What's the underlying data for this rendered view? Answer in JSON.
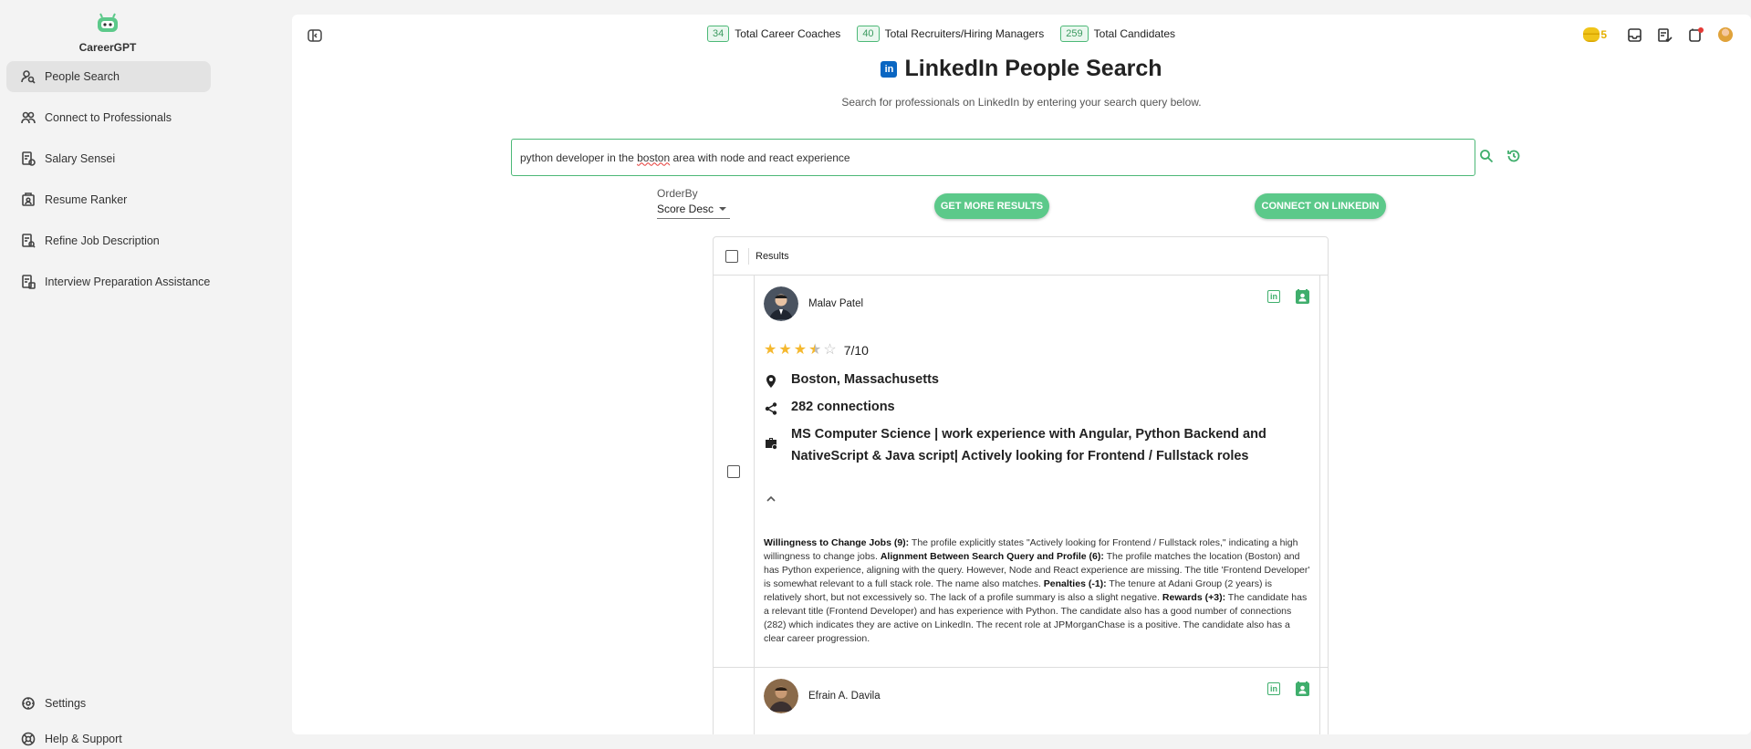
{
  "app": {
    "name": "CareerGPT"
  },
  "sidebar": {
    "items": [
      {
        "label": "People Search",
        "icon": "person-search-icon",
        "active": true
      },
      {
        "label": "Connect to Professionals",
        "icon": "people-icon",
        "active": false
      },
      {
        "label": "Salary Sensei",
        "icon": "salary-doc-icon",
        "active": false
      },
      {
        "label": "Resume Ranker",
        "icon": "resume-icon",
        "active": false
      },
      {
        "label": "Refine Job Description",
        "icon": "job-description-icon",
        "active": false
      },
      {
        "label": "Interview Preparation Assistance",
        "icon": "interview-icon",
        "active": false
      }
    ],
    "bottom": [
      {
        "label": "Settings",
        "icon": "settings-icon"
      },
      {
        "label": "Help & Support",
        "icon": "help-icon"
      }
    ]
  },
  "stats": [
    {
      "count": "34",
      "label": "Total Career Coaches"
    },
    {
      "count": "40",
      "label": "Total Recruiters/Hiring Managers"
    },
    {
      "count": "259",
      "label": "Total Candidates"
    }
  ],
  "header": {
    "coins": "5"
  },
  "page": {
    "title": "LinkedIn People Search",
    "linkedin_badge": "in",
    "subtitle": "Search for professionals on LinkedIn by entering your search query below."
  },
  "search": {
    "query_before": "python developer in the ",
    "query_misspelled": "boston",
    "query_after": " area with node and react experience"
  },
  "orderby": {
    "label": "OrderBy",
    "value": "Score Desc"
  },
  "buttons": {
    "more": "GET MORE RESULTS",
    "connect": "CONNECT ON LINKEDIN"
  },
  "results": {
    "header": "Results",
    "rows": [
      {
        "name": "Malav Patel",
        "rating": "7/10",
        "location": "Boston, Massachusetts",
        "connections": "282 connections",
        "headline_1": "MS Computer Science | work experience with Angular, Python Backend and",
        "headline_2": "NativeScript & Java script| Actively looking for Frontend / Fullstack roles",
        "summary": [
          {
            "b": "Willingness to Change Jobs (9):",
            "t": " The profile explicitly states \"Actively looking for Frontend / Fullstack roles,\" indicating a high willingness to change jobs. "
          },
          {
            "b": "Alignment Between Search Query and Profile (6):",
            "t": " The profile matches the location (Boston) and has Python experience, aligning with the query. However, Node and React experience are missing. The title 'Frontend Developer' is somewhat relevant to a full stack role. The name also matches. "
          },
          {
            "b": "Penalties (-1):",
            "t": " The tenure at Adani Group (2 years) is relatively short, but not excessively so. The lack of a profile summary is also a slight negative. "
          },
          {
            "b": "Rewards (+3):",
            "t": " The candidate has a relevant title (Frontend Developer) and has experience with Python. The candidate also has a good number of connections (282) which indicates they are active on LinkedIn. The recent role at JPMorganChase is a positive. The candidate also has a clear career progression."
          }
        ]
      },
      {
        "name": "Efrain A. Davila"
      }
    ]
  },
  "colors": {
    "accent": "#4cb877",
    "button": "#5cc98a",
    "linkedin": "#0a66c2",
    "star": "#f5b82e"
  }
}
